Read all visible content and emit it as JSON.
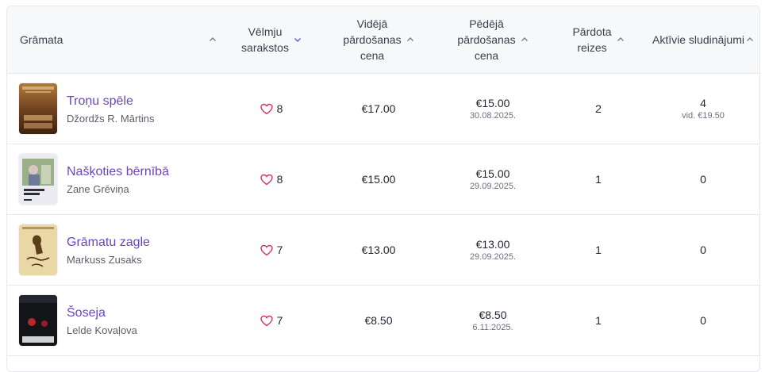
{
  "table": {
    "headers": {
      "book": "Grāmata",
      "wishlist_line1": "Vēlmju",
      "wishlist_line2": "sarakstos",
      "avg_line1": "Vidējā",
      "avg_line2": "pārdošanas",
      "avg_line3": "cena",
      "last_line1": "Pēdējā",
      "last_line2": "pārdošanas",
      "last_line3": "cena",
      "sold_line1": "Pārdota",
      "sold_line2": "reizes",
      "active": "Aktīvie sludinājumi"
    },
    "rows": [
      {
        "title": "Troņu spēle",
        "author": "Džordžs R. Mārtins",
        "wishlist": "8",
        "avg_price": "€17.00",
        "last_price": "€15.00",
        "last_date": "30.08.2025.",
        "sold": "2",
        "active": "4",
        "active_sub": "vid. €19.50",
        "cover_color": "#7a4a26"
      },
      {
        "title": "Našķoties bērnībā",
        "author": "Zane Grēviņa",
        "wishlist": "8",
        "avg_price": "€15.00",
        "last_price": "€15.00",
        "last_date": "29.09.2025.",
        "sold": "1",
        "active": "0",
        "active_sub": "",
        "cover_color": "#e8e6ef"
      },
      {
        "title": "Grāmatu zagle",
        "author": "Markuss Zusaks",
        "wishlist": "7",
        "avg_price": "€13.00",
        "last_price": "€13.00",
        "last_date": "29.09.2025.",
        "sold": "1",
        "active": "0",
        "active_sub": "",
        "cover_color": "#e9d3a0"
      },
      {
        "title": "Šoseja",
        "author": "Lelde Kovaļova",
        "wishlist": "7",
        "avg_price": "€8.50",
        "last_price": "€8.50",
        "last_date": "6.11.2025.",
        "sold": "1",
        "active": "0",
        "active_sub": "",
        "cover_color": "#121418"
      }
    ]
  },
  "icons": {
    "sort_up": "chevron-up-icon",
    "sort_down": "chevron-down-icon",
    "heart": "heart-icon"
  },
  "colors": {
    "accent": "#6c46b8",
    "heart": "#d6336c",
    "sort_active": "#5b5bd6"
  }
}
